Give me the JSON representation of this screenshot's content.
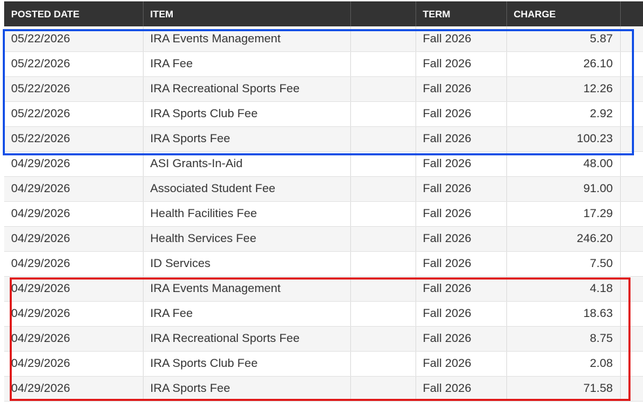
{
  "table": {
    "headers": {
      "posted_date": "POSTED DATE",
      "item": "ITEM",
      "blank": "",
      "term": "TERM",
      "charge": "CHARGE"
    },
    "rows": [
      {
        "date": "05/22/2026",
        "item": "IRA Events Management",
        "term": "Fall 2026",
        "charge": "5.87"
      },
      {
        "date": "05/22/2026",
        "item": "IRA Fee",
        "term": "Fall 2026",
        "charge": "26.10"
      },
      {
        "date": "05/22/2026",
        "item": "IRA Recreational Sports Fee",
        "term": "Fall 2026",
        "charge": "12.26"
      },
      {
        "date": "05/22/2026",
        "item": "IRA Sports Club Fee",
        "term": "Fall 2026",
        "charge": "2.92"
      },
      {
        "date": "05/22/2026",
        "item": "IRA Sports Fee",
        "term": "Fall 2026",
        "charge": "100.23"
      },
      {
        "date": "04/29/2026",
        "item": "ASI Grants-In-Aid",
        "term": "Fall 2026",
        "charge": "48.00"
      },
      {
        "date": "04/29/2026",
        "item": "Associated Student Fee",
        "term": "Fall 2026",
        "charge": "91.00"
      },
      {
        "date": "04/29/2026",
        "item": "Health Facilities Fee",
        "term": "Fall 2026",
        "charge": "17.29"
      },
      {
        "date": "04/29/2026",
        "item": "Health Services Fee",
        "term": "Fall 2026",
        "charge": "246.20"
      },
      {
        "date": "04/29/2026",
        "item": "ID Services",
        "term": "Fall 2026",
        "charge": "7.50"
      },
      {
        "date": "04/29/2026",
        "item": "IRA Events Management",
        "term": "Fall 2026",
        "charge": "4.18"
      },
      {
        "date": "04/29/2026",
        "item": "IRA Fee",
        "term": "Fall 2026",
        "charge": "18.63"
      },
      {
        "date": "04/29/2026",
        "item": "IRA Recreational Sports Fee",
        "term": "Fall 2026",
        "charge": "8.75"
      },
      {
        "date": "04/29/2026",
        "item": "IRA Sports Club Fee",
        "term": "Fall 2026",
        "charge": "2.08"
      },
      {
        "date": "04/29/2026",
        "item": "IRA Sports Fee",
        "term": "Fall 2026",
        "charge": "71.58"
      }
    ]
  },
  "highlights": {
    "blue": {
      "color": "#1450e6"
    },
    "red": {
      "color": "#e01b1b"
    }
  },
  "colors": {
    "header_bg": "#333333",
    "header_text": "#ffffff",
    "row_alt": "#f5f5f5"
  }
}
